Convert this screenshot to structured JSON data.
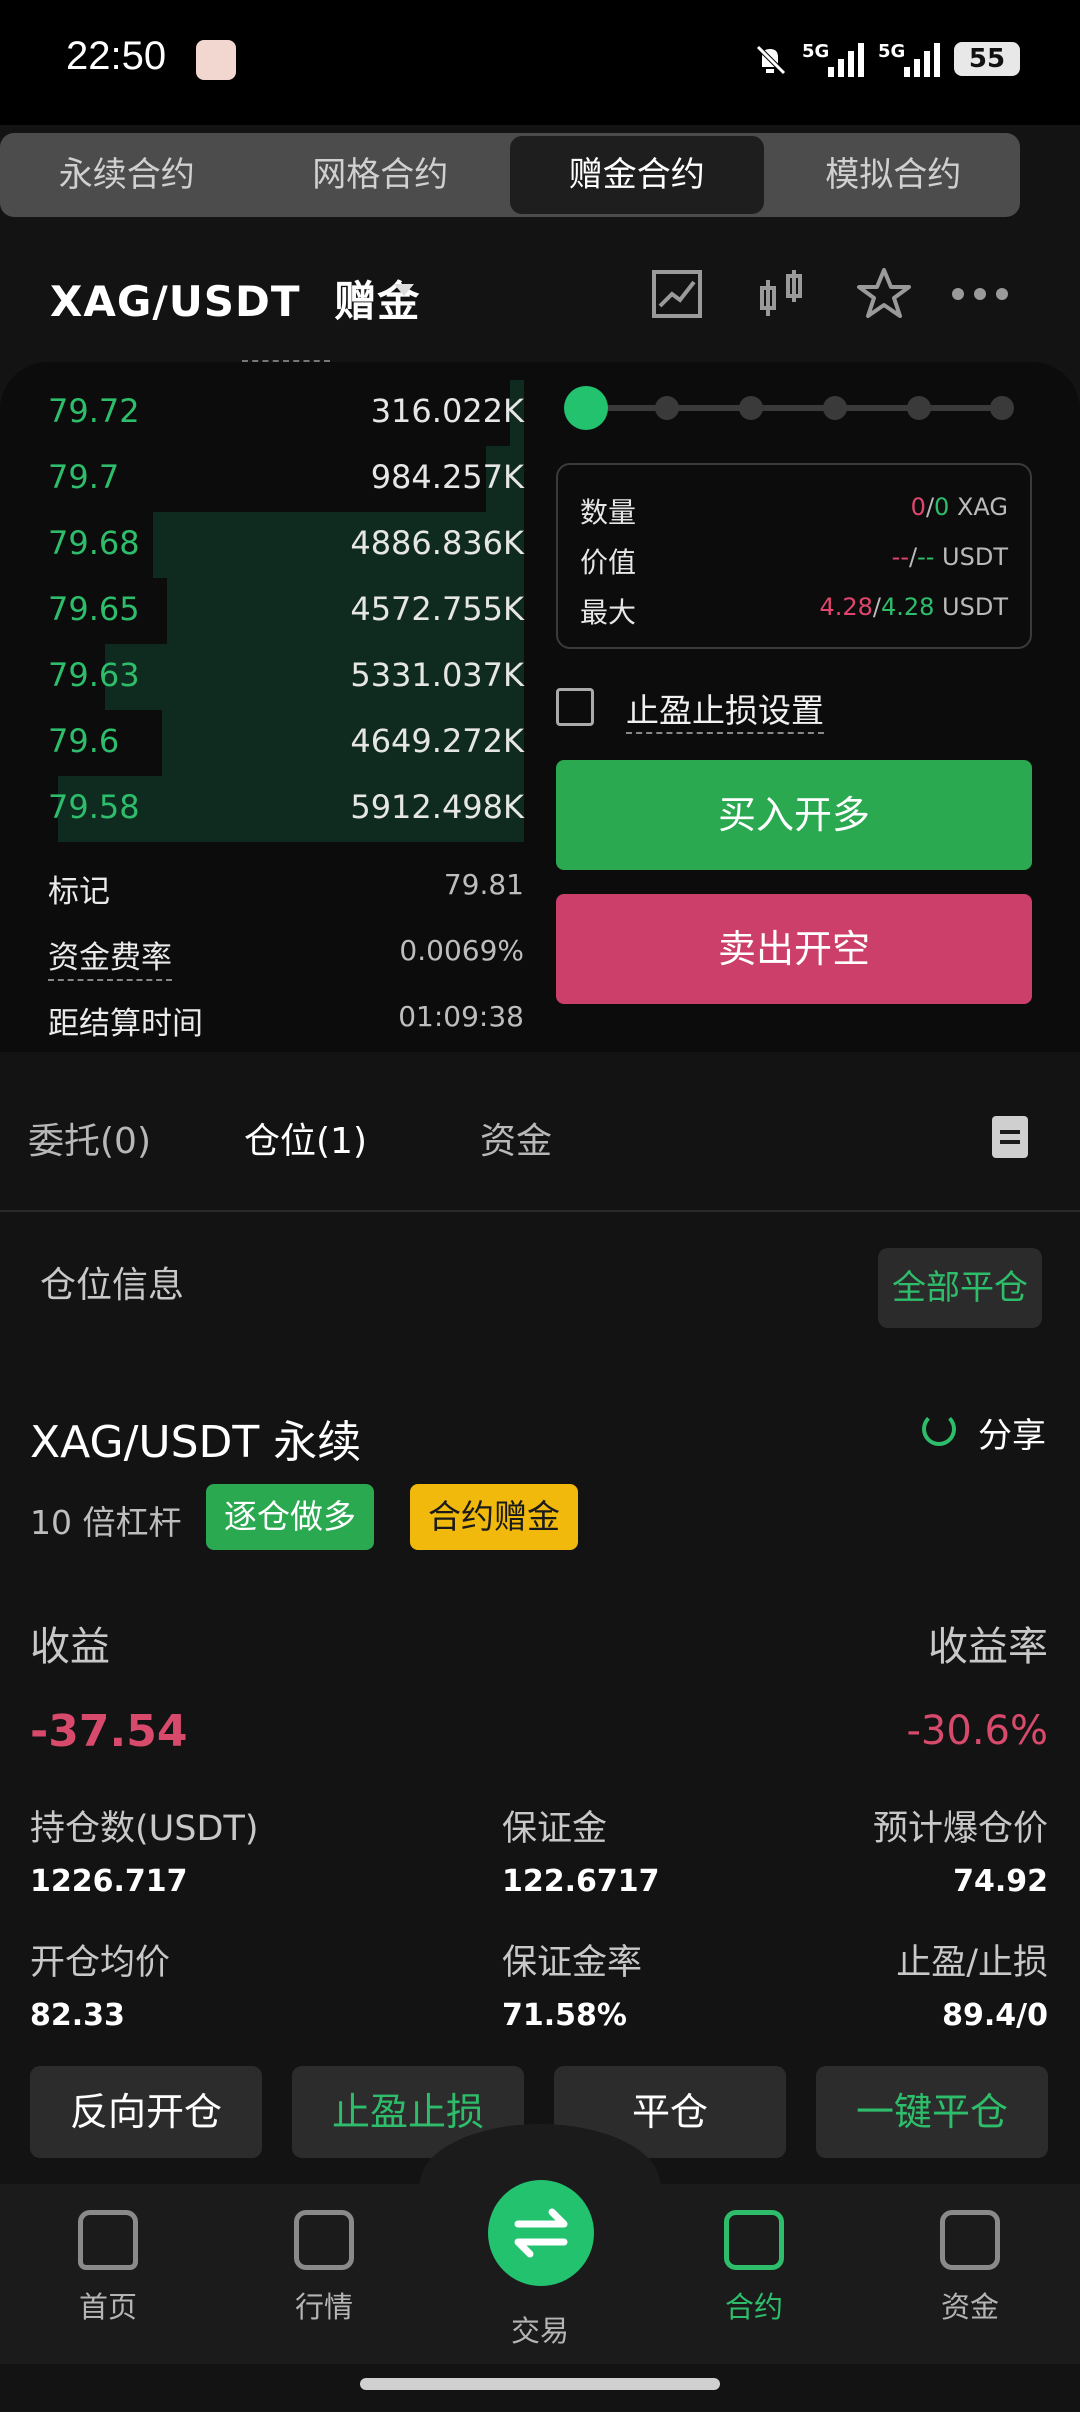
{
  "status_bar": {
    "time": "22:50",
    "network_1": "5G",
    "network_2": "5G",
    "battery": "55"
  },
  "contract_tabs": [
    "永续合约",
    "网格合约",
    "赠金合约",
    "模拟合约"
  ],
  "header": {
    "pair": "XAG/USDT",
    "mode": "赠金"
  },
  "orderbook": [
    {
      "price": "79.72",
      "size": "316.022K",
      "depth": 0.03
    },
    {
      "price": "79.7",
      "size": "984.257K",
      "depth": 0.08
    },
    {
      "price": "79.68",
      "size": "4886.836K",
      "depth": 0.78
    },
    {
      "price": "79.65",
      "size": "4572.755K",
      "depth": 0.75
    },
    {
      "price": "79.63",
      "size": "5331.037K",
      "depth": 0.88
    },
    {
      "price": "79.6",
      "size": "4649.272K",
      "depth": 0.76
    },
    {
      "price": "79.58",
      "size": "5912.498K",
      "depth": 0.98
    }
  ],
  "market_stats": {
    "mark_label": "标记",
    "mark_value": "79.81",
    "funding_label": "资金费率",
    "funding_value": "0.0069%",
    "settle_label": "距结算时间",
    "settle_value": "01:09:38"
  },
  "order_form": {
    "qty_label": "数量",
    "qty_a": "0",
    "qty_sep": "/",
    "qty_b": "0",
    "qty_unit": "XAG",
    "value_label": "价值",
    "value_a": "--",
    "value_sep": "/",
    "value_b": "--",
    "value_unit": "USDT",
    "max_label": "最大",
    "max_a": "4.28",
    "max_sep": "/",
    "max_b": "4.28",
    "max_unit": "USDT",
    "tpsl_label": "止盈止损设置",
    "buy_label": "买入开多",
    "sell_label": "卖出开空"
  },
  "section_tabs": [
    "委托(0)",
    "仓位(1)",
    "资金"
  ],
  "position": {
    "info_label": "仓位信息",
    "close_all_label": "全部平仓",
    "pair_label": "XAG/USDT 永续",
    "share_label": "分享",
    "leverage": "10 倍杠杆",
    "badge_mode": "逐仓做多",
    "badge_bonus": "合约赠金",
    "pnl_label": "收益",
    "pnl_value": "-37.54",
    "roe_label": "收益率",
    "roe_value": "-30.6%",
    "size_label": "持仓数(USDT)",
    "size_value": "1226.717",
    "margin_label": "保证金",
    "margin_value": "122.6717",
    "liq_label": "预计爆仓价",
    "liq_value": "74.92",
    "entry_label": "开仓均价",
    "entry_value": "82.33",
    "margin_ratio_label": "保证金率",
    "margin_ratio_value": "71.58%",
    "tpsl_label": "止盈/止损",
    "tpsl_value": "89.4/0"
  },
  "actions": [
    "反向开仓",
    "止盈止损",
    "平仓",
    "一键平仓"
  ],
  "bottom_nav": [
    "首页",
    "行情",
    "交易",
    "合约",
    "资金"
  ],
  "colors": {
    "green": "#2ebd6a",
    "red": "#d84a6c",
    "buy": "#2aa950",
    "sell": "#cc3f6b",
    "bonus": "#f0b90b"
  }
}
